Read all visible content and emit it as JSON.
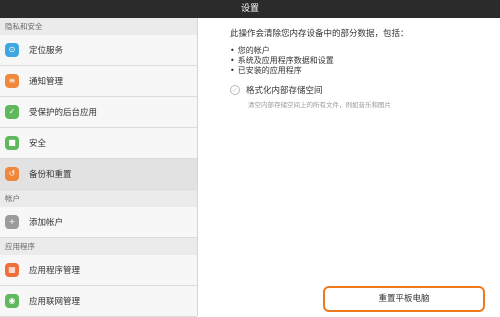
{
  "window": {
    "title": "设置"
  },
  "sidebar": {
    "sections": [
      {
        "label": "隐私和安全",
        "items": [
          {
            "label": "定位服务",
            "icon": "location-pin-icon",
            "color": "#3ea7e2"
          },
          {
            "label": "通知管理",
            "icon": "notification-icon",
            "color": "#f0883c"
          },
          {
            "label": "受保护的后台应用",
            "icon": "protected-apps-icon",
            "color": "#60b85c"
          },
          {
            "label": "安全",
            "icon": "lock-icon",
            "color": "#60b85c"
          },
          {
            "label": "备份和重置",
            "icon": "backup-restore-icon",
            "color": "#f0883c",
            "active": true
          }
        ]
      },
      {
        "label": "帐户",
        "items": [
          {
            "label": "添加帐户",
            "icon": "plus-icon",
            "color": "#9b9b9b"
          }
        ]
      },
      {
        "label": "应用程序",
        "items": [
          {
            "label": "应用程序管理",
            "icon": "grid-apps-icon",
            "color": "#ef6e3a"
          },
          {
            "label": "应用联网管理",
            "icon": "network-icon",
            "color": "#60b85c"
          }
        ]
      }
    ]
  },
  "content": {
    "description": "此操作会清除您内存设备中的部分数据，包括：",
    "bullets": [
      "您的帐户",
      "系统及应用程序数据和设置",
      "已安装的应用程序"
    ],
    "checkbox": {
      "label": "格式化内部存储空间",
      "sublabel": "清空内部存储空间上的所有文件，例如音乐和图片",
      "checked": false
    },
    "reset_button": "重置平板电脑"
  },
  "colors": {
    "titlebar": "#2b2b2b",
    "highlight": "#ee7a1e"
  }
}
